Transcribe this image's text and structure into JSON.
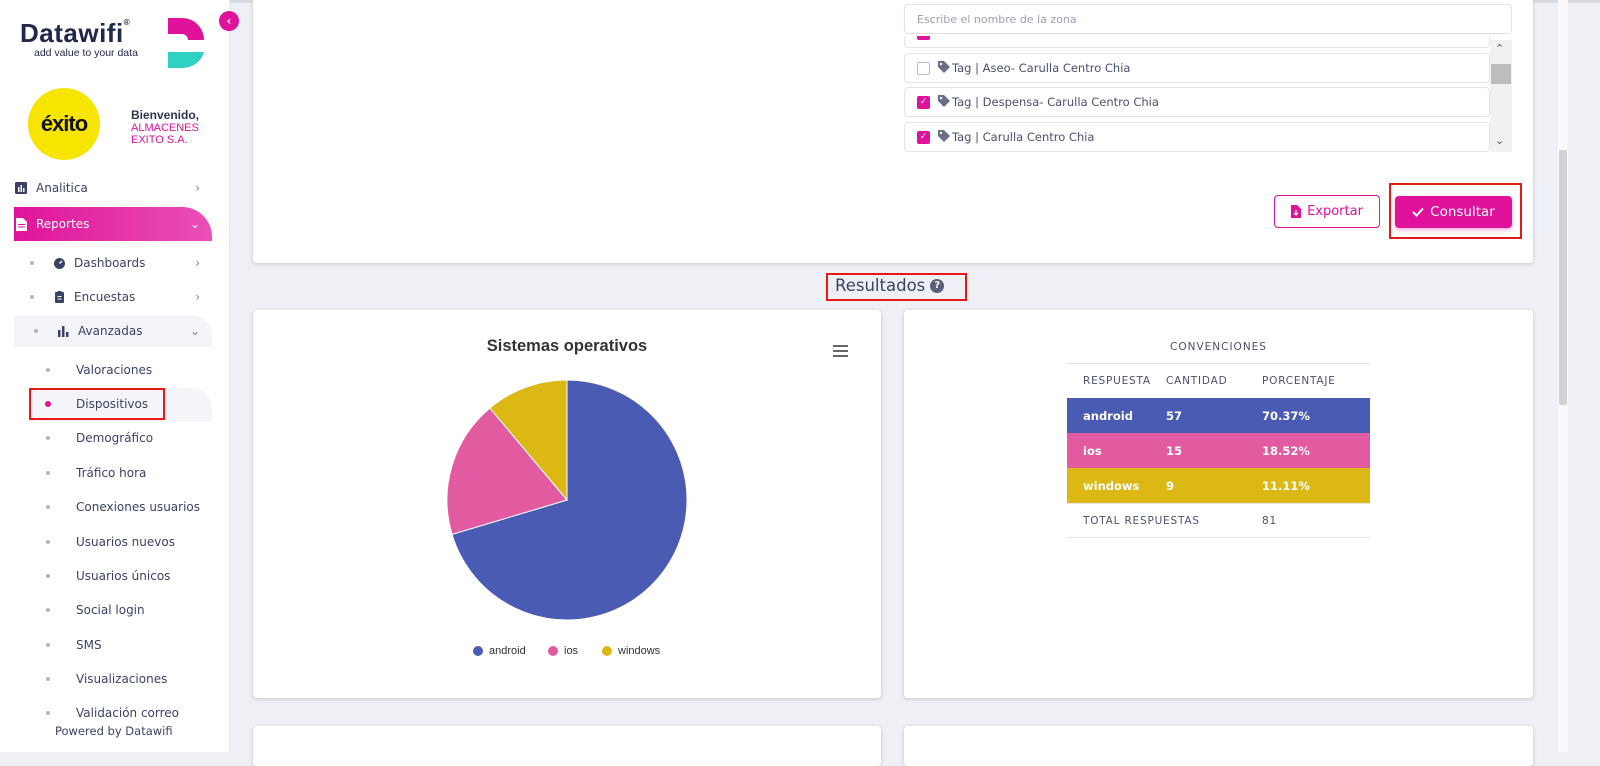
{
  "brand": {
    "name": "Datawifi",
    "registered": "®",
    "tagline": "add value to your data"
  },
  "user": {
    "logo_text": "éxito",
    "welcome": "Bienvenido,",
    "company": "ALMACENES EXITO S.A."
  },
  "sidebar": {
    "items": [
      {
        "label": "Analitica"
      },
      {
        "label": "Reportes"
      },
      {
        "label": "Dashboards"
      },
      {
        "label": "Encuestas"
      },
      {
        "label": "Avanzadas"
      }
    ],
    "sub_items": [
      {
        "label": "Valoraciones"
      },
      {
        "label": "Dispositivos"
      },
      {
        "label": "Demográfico"
      },
      {
        "label": "Tráfico hora"
      },
      {
        "label": "Conexiones usuarios"
      },
      {
        "label": "Usuarios nuevos"
      },
      {
        "label": "Usuarios únicos"
      },
      {
        "label": "Social login"
      },
      {
        "label": "SMS"
      },
      {
        "label": "Visualizaciones"
      },
      {
        "label": "Validación correo"
      }
    ],
    "footer": "Powered by Datawifi"
  },
  "filters": {
    "zone_placeholder": "Escribe el nombre de la zona",
    "zones": [
      {
        "label": "Tag | Aseo- Carulla Centro Chia",
        "checked": false
      },
      {
        "label": "Tag | Despensa- Carulla Centro Chia",
        "checked": true
      },
      {
        "label": "Tag | Carulla Centro Chia",
        "checked": true
      }
    ],
    "export_label": "Exportar",
    "query_label": "Consultar"
  },
  "results": {
    "title": "Resultados",
    "table_title": "CONVENCIONES",
    "headers": [
      "RESPUESTA",
      "CANTIDAD",
      "PORCENTAJE"
    ],
    "rows": [
      {
        "label": "android",
        "count": "57",
        "percent": "70.37%",
        "color": "#4a5bb3"
      },
      {
        "label": "ios",
        "count": "15",
        "percent": "18.52%",
        "color": "#e25a9f"
      },
      {
        "label": "windows",
        "count": "9",
        "percent": "11.11%",
        "color": "#dbb814"
      }
    ],
    "total_label": "TOTAL RESPUESTAS",
    "total_value": "81"
  },
  "chart_data": {
    "type": "pie",
    "title": "Sistemas operativos",
    "categories": [
      "android",
      "ios",
      "windows"
    ],
    "values": [
      57,
      15,
      9
    ],
    "colors": [
      "#4a5bb3",
      "#e25a9f",
      "#dbb814"
    ],
    "legend": "bottom"
  }
}
